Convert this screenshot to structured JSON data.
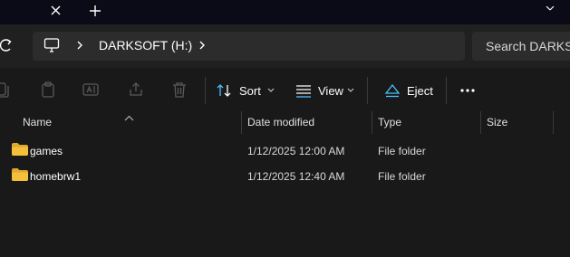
{
  "titlebar": {
    "tab_close_icon": "close-icon",
    "new_tab_icon": "plus-icon"
  },
  "address": {
    "location_icon": "this-pc-icon",
    "breadcrumb": "DARKSOFT (H:)",
    "search_placeholder": "Search DARKSOFT"
  },
  "toolbar": {
    "sort_label": "Sort",
    "view_label": "View",
    "eject_label": "Eject",
    "more_icon": "more-icon"
  },
  "columns": {
    "name": "Name",
    "date_modified": "Date modified",
    "type": "Type",
    "size": "Size"
  },
  "files": [
    {
      "name": "games",
      "date_modified": "1/12/2025 12:00 AM",
      "type": "File folder",
      "size": ""
    },
    {
      "name": "homebrw1",
      "date_modified": "1/12/2025 12:40 AM",
      "type": "File folder",
      "size": ""
    }
  ],
  "colors": {
    "accent": "#4cc2ff",
    "folder": "#f3c03c",
    "background": "#191919",
    "titlebar": "#0b0b18"
  }
}
